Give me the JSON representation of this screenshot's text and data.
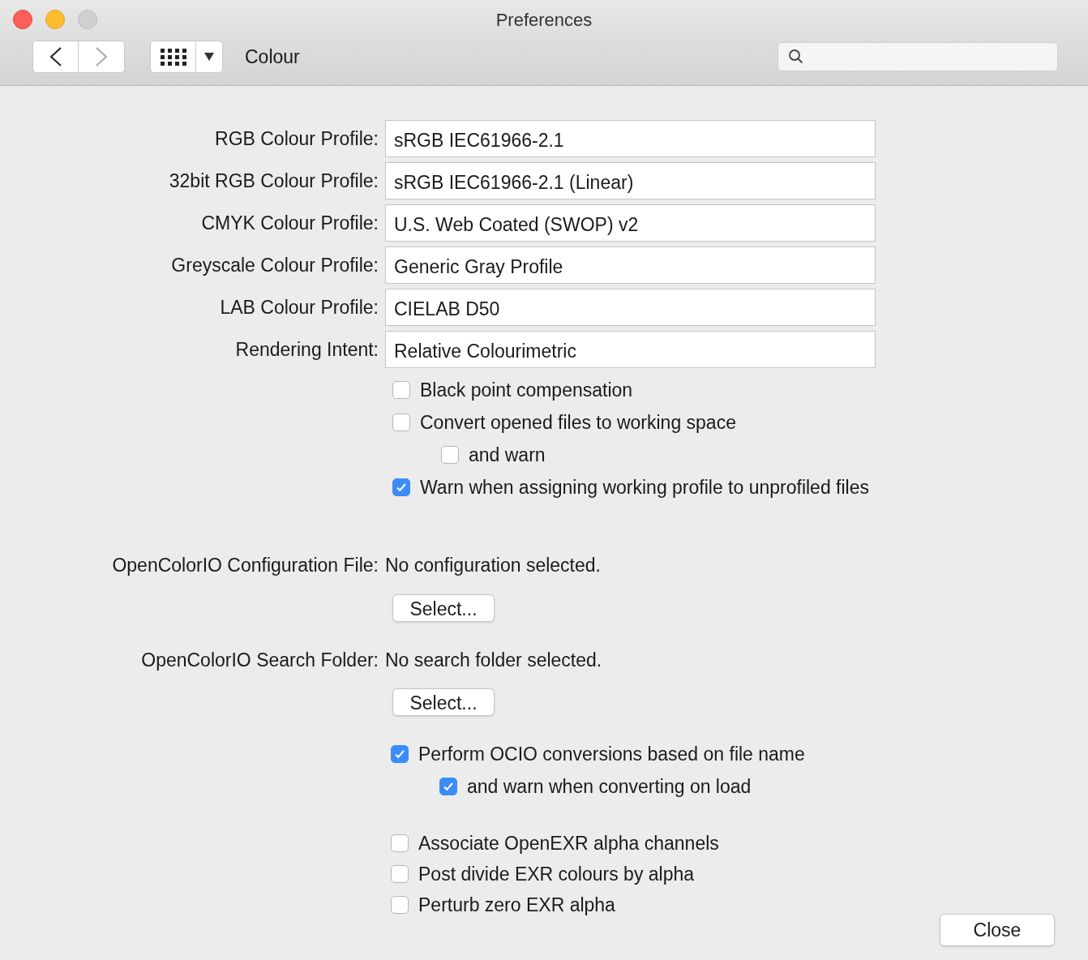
{
  "window": {
    "title": "Preferences"
  },
  "toolbar": {
    "section_title": "Colour"
  },
  "profiles": [
    {
      "label": "RGB Colour Profile:",
      "value": "sRGB IEC61966-2.1"
    },
    {
      "label": "32bit RGB Colour Profile:",
      "value": "sRGB IEC61966-2.1 (Linear)"
    },
    {
      "label": "CMYK Colour Profile:",
      "value": "U.S. Web Coated (SWOP) v2"
    },
    {
      "label": "Greyscale Colour Profile:",
      "value": "Generic Gray Profile"
    },
    {
      "label": "LAB Colour Profile:",
      "value": "CIELAB D50"
    },
    {
      "label": "Rendering Intent:",
      "value": "Relative Colourimetric"
    }
  ],
  "options": [
    {
      "label": "Black point compensation",
      "checked": false
    },
    {
      "label": "Convert opened files to working space",
      "checked": false,
      "children": [
        {
          "label": "and warn",
          "checked": false
        }
      ]
    },
    {
      "label": "Warn when assigning working profile to unprofiled files",
      "checked": true
    }
  ],
  "ocio_config": {
    "label": "OpenColorIO Configuration File:",
    "value": "No configuration selected.",
    "button": "Select..."
  },
  "ocio_search": {
    "label": "OpenColorIO Search Folder:",
    "value": "No search folder selected.",
    "button": "Select..."
  },
  "ocio_options": [
    {
      "label": "Perform OCIO conversions based on file name",
      "checked": true,
      "children": [
        {
          "label": "and warn when converting on load",
          "checked": true
        }
      ]
    }
  ],
  "exr_options": [
    {
      "label": "Associate OpenEXR alpha channels",
      "checked": false
    },
    {
      "label": "Post divide EXR colours by alpha",
      "checked": false
    },
    {
      "label": "Perturb zero EXR alpha",
      "checked": false
    }
  ],
  "close_button": "Close"
}
